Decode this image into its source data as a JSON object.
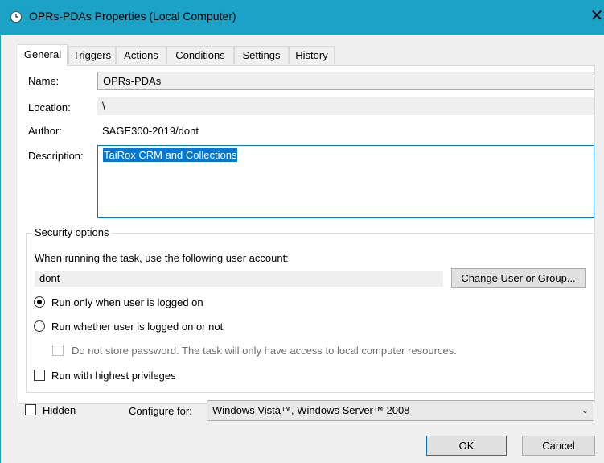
{
  "window": {
    "title": "OPRs-PDAs Properties (Local Computer)",
    "close_glyph": "✕",
    "title_icon": "clock-icon"
  },
  "tabs": [
    {
      "label": "General",
      "active": true
    },
    {
      "label": "Triggers",
      "active": false
    },
    {
      "label": "Actions",
      "active": false
    },
    {
      "label": "Conditions",
      "active": false
    },
    {
      "label": "Settings",
      "active": false
    },
    {
      "label": "History",
      "active": false
    }
  ],
  "general": {
    "name_label": "Name:",
    "name_value": "OPRs-PDAs",
    "location_label": "Location:",
    "location_value": "\\",
    "author_label": "Author:",
    "author_value": "SAGE300-2019/dont",
    "description_label": "Description:",
    "description_value": "TaiRox CRM and Collections"
  },
  "security": {
    "group_title": "Security options",
    "account_prompt": "When running the task, use the following user account:",
    "account_value": "dont",
    "change_button": "Change User or Group...",
    "radio_logged_on": {
      "label": "Run only when user is logged on",
      "selected": true
    },
    "radio_whether": {
      "label": "Run whether user is logged on or not",
      "selected": false
    },
    "no_store_password": {
      "label": "Do not store password.  The task will only have access to local computer resources.",
      "checked": false,
      "enabled": false
    },
    "highest_privileges": {
      "label": "Run with highest privileges",
      "checked": false
    }
  },
  "footer": {
    "hidden_label": "Hidden",
    "hidden_checked": false,
    "configure_label": "Configure for:",
    "configure_value": "Windows Vista™, Windows Server™ 2008",
    "ok_label": "OK",
    "cancel_label": "Cancel"
  },
  "colors": {
    "titlebar": "#1aa3c6",
    "selection": "#0078d7",
    "dialog_bg": "#f0f0f0"
  }
}
